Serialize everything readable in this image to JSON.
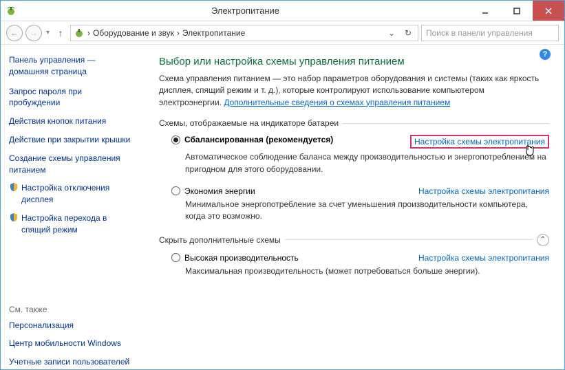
{
  "window": {
    "title": "Электропитание"
  },
  "nav": {
    "crumb1": "Оборудование и звук",
    "crumb2": "Электропитание"
  },
  "search": {
    "placeholder": "Поиск в панели управления"
  },
  "sidebar": {
    "home": "Панель управления — домашняя страница",
    "links": [
      "Запрос пароля при пробуждении",
      "Действия кнопок питания",
      "Действие при закрытии крышки",
      "Создание схемы управления питанием",
      "Настройка отключения дисплея",
      "Настройка перехода в спящий режим"
    ],
    "seealso": "См. также",
    "seealso_links": [
      "Персонализация",
      "Центр мобильности Windows",
      "Учетные записи пользователей"
    ]
  },
  "main": {
    "heading": "Выбор или настройка схемы управления питанием",
    "desc_pre": "Схема управления питанием — это набор параметров оборудования и системы (таких как яркость дисплея, спящий режим и т. д.), которые контролируют использование компьютером электроэнергии. ",
    "desc_link": "Дополнительные сведения о схемах управления питанием",
    "section1": "Схемы, отображаемые на индикаторе батареи",
    "section2": "Скрыть дополнительные схемы",
    "plans": [
      {
        "name": "Сбалансированная (рекомендуется)",
        "link": "Настройка схемы электропитания",
        "desc": "Автоматическое соблюдение баланса между производительностью и энергопотреблением на пригодном для этого оборудовании.",
        "checked": true,
        "highlight": true
      },
      {
        "name": "Экономия энергии",
        "link": "Настройка схемы электропитания",
        "desc": "Минимальное энергопотребление за счет уменьшения производительности компьютера, когда это возможно.",
        "checked": false,
        "highlight": false
      }
    ],
    "extra_plans": [
      {
        "name": "Высокая производительность",
        "link": "Настройка схемы электропитания",
        "desc": "Максимальная производительность (может потребоваться больше энергии).",
        "checked": false
      }
    ]
  }
}
